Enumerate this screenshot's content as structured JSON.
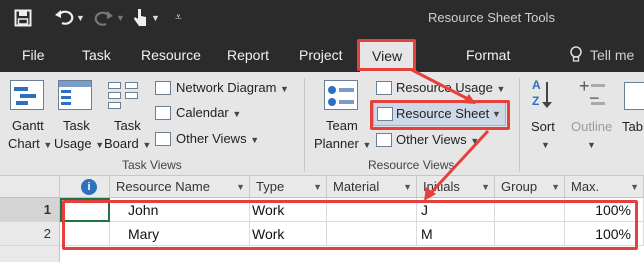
{
  "titlebar": {
    "context_label": "Resource Sheet Tools"
  },
  "tabs": [
    {
      "label": "File"
    },
    {
      "label": "Task"
    },
    {
      "label": "Resource"
    },
    {
      "label": "Report"
    },
    {
      "label": "Project"
    },
    {
      "label": "View"
    },
    {
      "label": "Format"
    }
  ],
  "tell_me": {
    "label": "Tell me"
  },
  "ribbon": {
    "gantt_chart": {
      "line1": "Gantt",
      "line2": "Chart"
    },
    "task_usage": {
      "line1": "Task",
      "line2": "Usage"
    },
    "task_board": {
      "line1": "Task",
      "line2": "Board"
    },
    "network_diagram": "Network Diagram",
    "calendar": "Calendar",
    "task_other_views": "Other Views",
    "task_views_group": "Task Views",
    "team_planner": {
      "line1": "Team",
      "line2": "Planner"
    },
    "resource_usage": "Resource Usage",
    "resource_sheet": "Resource Sheet",
    "resource_other_views": "Other Views",
    "resource_views_group": "Resource Views",
    "sort": "Sort",
    "outline": "Outline",
    "tables": "Tab"
  },
  "grid": {
    "info_icon": "i",
    "columns": [
      "Resource Name",
      "Type",
      "Material",
      "Initials",
      "Group",
      "Max."
    ],
    "rows": [
      {
        "num": "1",
        "name": "John",
        "type": "Work",
        "material": "",
        "initials": "J",
        "group": "",
        "max": "100%"
      },
      {
        "num": "2",
        "name": "Mary",
        "type": "Work",
        "material": "",
        "initials": "M",
        "group": "",
        "max": "100%"
      }
    ]
  },
  "colors": {
    "dark_chrome": "#2b2b2b",
    "ribbon_bg": "#e6e6e6",
    "highlight_red": "#e5403b",
    "info_blue": "#2f6fc0"
  }
}
